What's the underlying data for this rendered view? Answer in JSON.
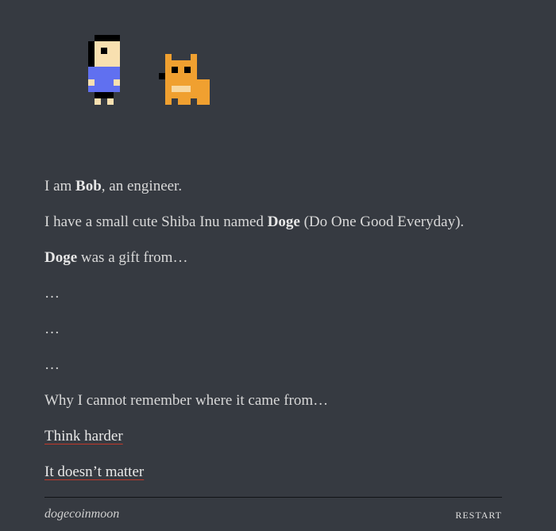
{
  "characters": {
    "bob": {
      "name": "bob-sprite",
      "shirt_color": "#6070f0",
      "skin_color": "#f8e0b0",
      "hair_color": "#000000"
    },
    "doge": {
      "name": "doge-sprite",
      "fur_color": "#f0a030",
      "belly_color": "#f8d8a0",
      "eye_color": "#000000"
    }
  },
  "story": {
    "line1": {
      "pre": "I am ",
      "bold": "Bob",
      "post": ", an engineer."
    },
    "line2": {
      "pre": "I have a small cute Shiba Inu named ",
      "bold": "Doge",
      "post": " (Do One Good Everyday)."
    },
    "line3": {
      "bold": "Doge",
      "post": " was a gift from…"
    },
    "ellipsis1": "…",
    "ellipsis2": "…",
    "ellipsis3": "…",
    "line4": "Why I cannot remember where it came from…"
  },
  "choices": {
    "think_harder": "Think harder",
    "doesnt_matter": "It doesn’t matter"
  },
  "footer": {
    "title": "dogecoinmoon",
    "restart": "RESTART"
  },
  "colors": {
    "background": "#363a41",
    "text": "#d8d8d8",
    "link_underline": "#c0392b"
  }
}
